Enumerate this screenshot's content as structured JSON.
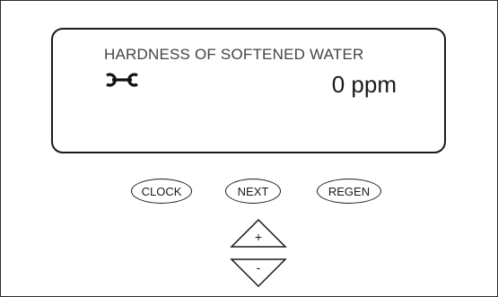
{
  "display": {
    "title": "HARDNESS OF SOFTENED WATER",
    "icon": "wrench-icon",
    "value": "0 ppm"
  },
  "buttons": {
    "clock": "CLOCK",
    "next": "NEXT",
    "regen": "REGEN",
    "up": "+",
    "down": "-"
  }
}
